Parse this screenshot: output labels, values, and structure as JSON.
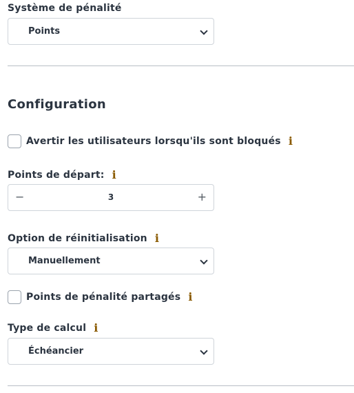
{
  "penalty_system": {
    "label": "Système de pénalité",
    "selected": "Points"
  },
  "configuration": {
    "heading": "Configuration",
    "warn_users": {
      "label": "Avertir les utilisateurs lorsqu'ils sont bloqués",
      "checked": false
    },
    "starting_points": {
      "label": "Points de départ:",
      "value": "3",
      "minus": "−",
      "plus": "+"
    },
    "reset_option": {
      "label": "Option de réinitialisation",
      "selected": "Manuellement"
    },
    "shared_points": {
      "label": "Points de pénalité partagés",
      "checked": false
    },
    "calculation_type": {
      "label": "Type de calcul",
      "selected": "Échéancier"
    }
  },
  "icons": {
    "info": "info-icon",
    "chevron": "chevron-down-icon"
  },
  "colors": {
    "text": "#2b3440",
    "border": "#cfd4da",
    "info_icon": "#8a5a00",
    "divider": "#b8bec5"
  }
}
